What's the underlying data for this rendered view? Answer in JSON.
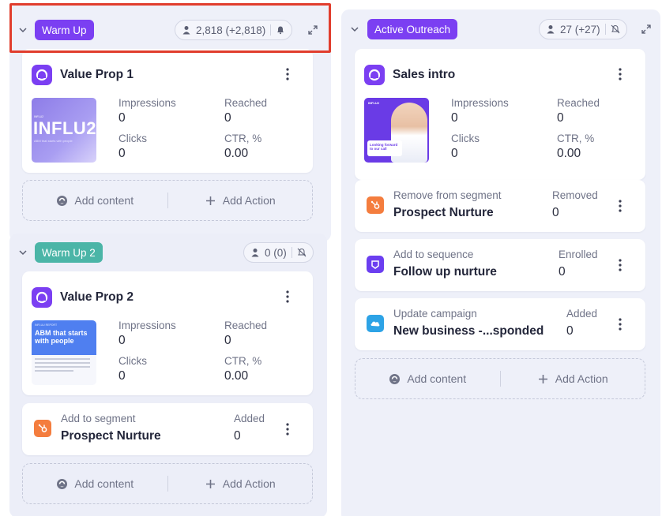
{
  "colors": {
    "purple_pill": "#7b3ff2",
    "teal_pill": "#4bb5a7",
    "highlight": "#e13d2d",
    "column_bg": "#eef0f9"
  },
  "left": {
    "segment_1": {
      "name": "Warm Up",
      "audience": "2,818 (+2,818)",
      "notification_icon": "bell-icon",
      "card": {
        "title": "Value Prop 1",
        "thumbnail": {
          "brand": "INFLU2",
          "small_top": "INFLU2",
          "caption": "ABM that starts with people"
        },
        "metrics": {
          "impressions_label": "Impressions",
          "impressions": "0",
          "reached_label": "Reached",
          "reached": "0",
          "clicks_label": "Clicks",
          "clicks": "0",
          "ctr_label": "CTR, %",
          "ctr": "0.00"
        }
      },
      "add_content": "Add content",
      "add_action": "Add Action"
    },
    "segment_2": {
      "name": "Warm Up 2",
      "audience": "0 (0)",
      "notification_icon": "bell-off-icon",
      "card": {
        "title": "Value Prop 2",
        "thumbnail": {
          "small_top": "INFLUU REPORT",
          "headline": "ABM that starts with people"
        },
        "metrics": {
          "impressions_label": "Impressions",
          "impressions": "0",
          "reached_label": "Reached",
          "reached": "0",
          "clicks_label": "Clicks",
          "clicks": "0",
          "ctr_label": "CTR, %",
          "ctr": "0.00"
        }
      },
      "action": {
        "top": "Add to segment",
        "main": "Prospect Nurture",
        "stat_label": "Added",
        "stat_value": "0"
      },
      "add_content": "Add content",
      "add_action": "Add Action"
    }
  },
  "right": {
    "segment": {
      "name": "Active Outreach",
      "audience": "27 (+27)",
      "notification_icon": "bell-off-icon",
      "card": {
        "title": "Sales intro",
        "thumbnail": {
          "brand": "INFLU2",
          "tag": "Looking forward to our call"
        },
        "metrics": {
          "impressions_label": "Impressions",
          "impressions": "0",
          "reached_label": "Reached",
          "reached": "0",
          "clicks_label": "Clicks",
          "clicks": "0",
          "ctr_label": "CTR, %",
          "ctr": "0.00"
        }
      },
      "actions": [
        {
          "top": "Remove from segment",
          "main": "Prospect Nurture",
          "stat_label": "Removed",
          "stat_value": "0",
          "icon": "hubspot-icon"
        },
        {
          "top": "Add to sequence",
          "main": "Follow up nurture",
          "stat_label": "Enrolled",
          "stat_value": "0",
          "icon": "sequence-icon"
        },
        {
          "top": "Update campaign",
          "main": "New business -...sponded",
          "stat_label": "Added",
          "stat_value": "0",
          "icon": "salesforce-icon"
        }
      ],
      "add_content": "Add content",
      "add_action": "Add Action"
    }
  }
}
